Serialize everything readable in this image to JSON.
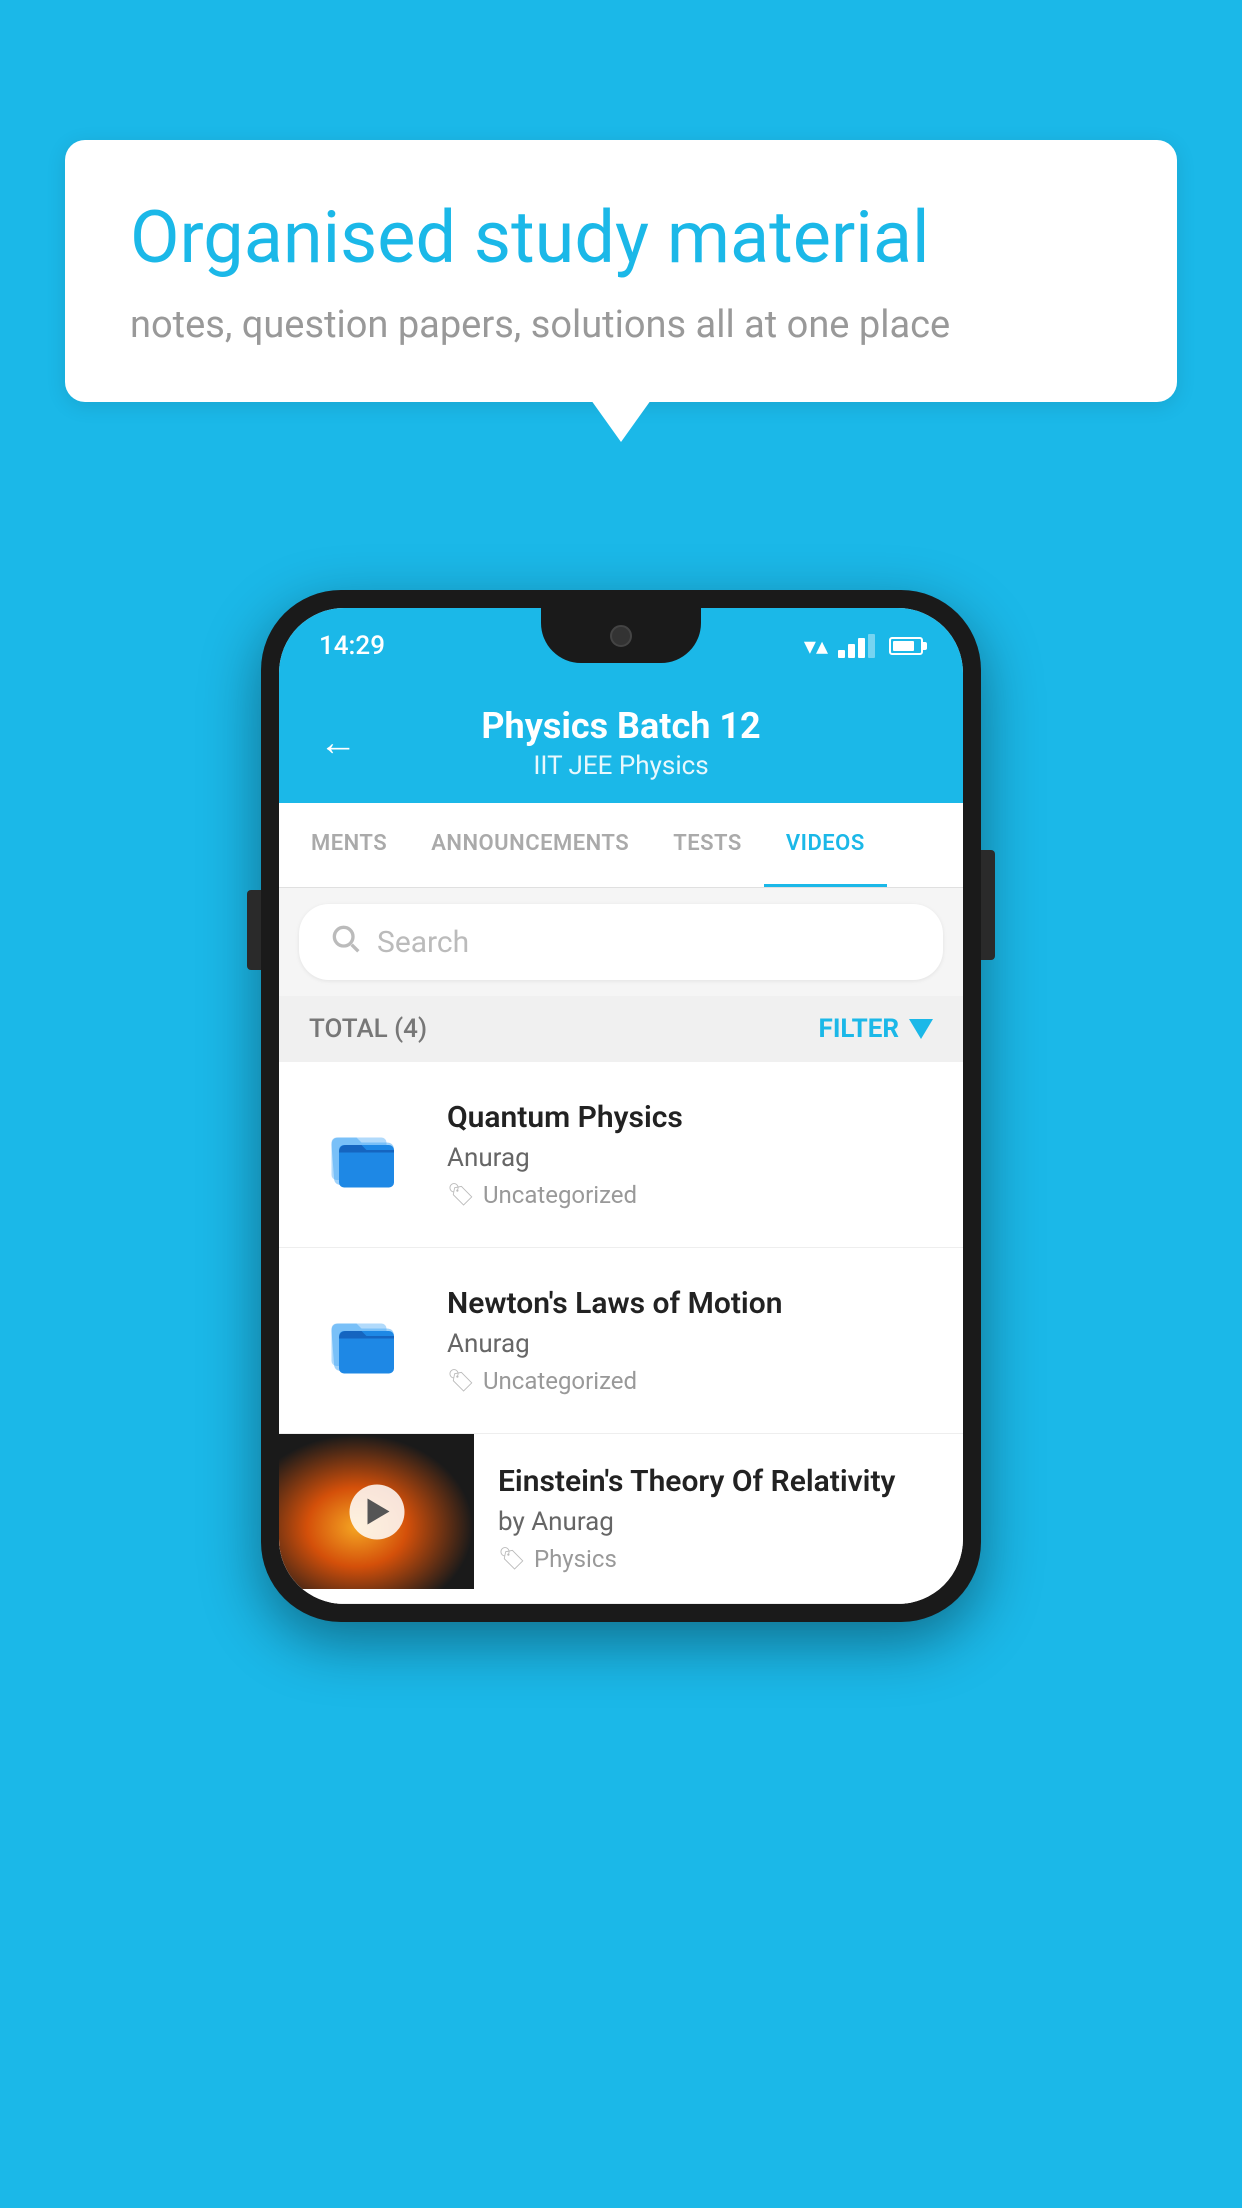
{
  "background": {
    "color": "#1bb8e8"
  },
  "speech_bubble": {
    "title": "Organised study material",
    "subtitle": "notes, question papers, solutions all at one place"
  },
  "phone": {
    "status_bar": {
      "time": "14:29"
    },
    "header": {
      "title": "Physics Batch 12",
      "subtitle": "IIT JEE   Physics",
      "back_label": "←"
    },
    "tabs": [
      {
        "label": "MENTS",
        "active": false
      },
      {
        "label": "ANNOUNCEMENTS",
        "active": false
      },
      {
        "label": "TESTS",
        "active": false
      },
      {
        "label": "VIDEOS",
        "active": true
      }
    ],
    "search": {
      "placeholder": "Search"
    },
    "filter_bar": {
      "total_label": "TOTAL (4)",
      "filter_label": "FILTER"
    },
    "videos": [
      {
        "title": "Quantum Physics",
        "author": "Anurag",
        "tag": "Uncategorized",
        "has_thumbnail": false
      },
      {
        "title": "Newton's Laws of Motion",
        "author": "Anurag",
        "tag": "Uncategorized",
        "has_thumbnail": false
      },
      {
        "title": "Einstein's Theory Of Relativity",
        "author": "by Anurag",
        "tag": "Physics",
        "has_thumbnail": true
      }
    ]
  }
}
